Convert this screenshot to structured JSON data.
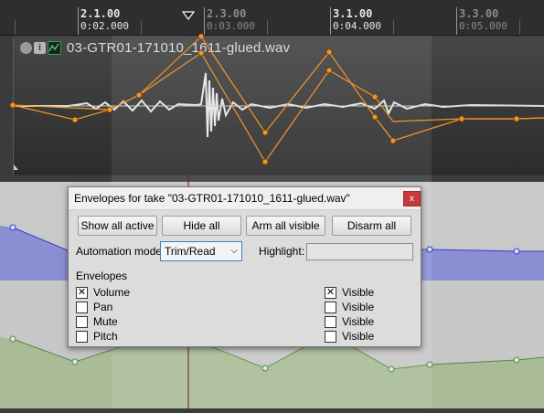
{
  "ruler": {
    "marks": [
      {
        "label": "2.1.00",
        "sub": "0:02.000",
        "active": true
      },
      {
        "label": "2.3.00",
        "sub": "0:03.000",
        "active": false
      },
      {
        "label": "3.1.00",
        "sub": "0:04.000",
        "active": true
      },
      {
        "label": "3.3.00",
        "sub": "0:05.000",
        "active": false
      }
    ]
  },
  "item": {
    "title": "03-GTR01-171010_1611-glued.wav",
    "icons": [
      "circle-icon",
      "info-icon",
      "envelope-icon"
    ]
  },
  "dialog": {
    "title": "Envelopes for take \"03-GTR01-171010_1611-glued.wav\"",
    "close_symbol": "x",
    "buttons": {
      "show_all_active": "Show all active",
      "hide_all": "Hide all",
      "arm_all_visible": "Arm all visible",
      "disarm_all": "Disarm all"
    },
    "automation_mode_label": "Automation mode:",
    "automation_mode_value": "Trim/Read",
    "highlight_label": "Highlight:",
    "highlight_value": "",
    "envelopes_label": "Envelopes",
    "envelopes": [
      {
        "name": "Volume",
        "checked": true,
        "visible_label": "Visible",
        "visible": true
      },
      {
        "name": "Pan",
        "checked": false,
        "visible_label": "Visible",
        "visible": false
      },
      {
        "name": "Mute",
        "checked": false,
        "visible_label": "Visible",
        "visible": false
      },
      {
        "name": "Pitch",
        "checked": false,
        "visible_label": "Visible",
        "visible": false
      }
    ]
  },
  "colors": {
    "take_envelope": "#f0962a",
    "volume_lane": "#8a8fd4",
    "volume_line": "#2d3ec9",
    "pan_lane": "#a9bb97",
    "pan_line": "#4f8b45",
    "playhead": "#7a1414",
    "close_button": "#c8393a"
  }
}
